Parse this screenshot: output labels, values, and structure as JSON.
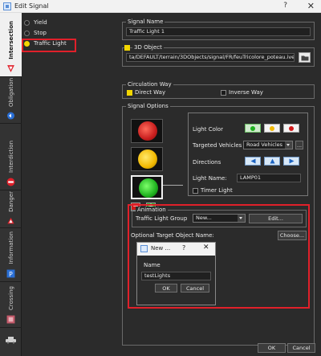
{
  "window": {
    "title": "Edit Signal",
    "help": "?",
    "close": "✕"
  },
  "tabs": [
    {
      "label": "Intersection"
    },
    {
      "label": "Obligation"
    },
    {
      "label": "Interdiction"
    },
    {
      "label": "Danger"
    },
    {
      "label": "Information"
    },
    {
      "label": "Crossing"
    }
  ],
  "signal_types": [
    {
      "label": "Yield",
      "selected": false
    },
    {
      "label": "Stop",
      "selected": false
    },
    {
      "label": "Traffic Light",
      "selected": true
    }
  ],
  "signal_name": {
    "label": "Signal Name",
    "value": "Traffic Light 1"
  },
  "object3d": {
    "label": "3D Object",
    "path": "ta/DEFAULT/terrain/3DObjects/signal/FR/feuTricolore_poteau.ive"
  },
  "circulation": {
    "label": "Circulation Way",
    "direct": "Direct Way",
    "inverse": "Inverse Way"
  },
  "options": {
    "label": "Signal Options",
    "light_color_label": "Light Color",
    "targeted_vehicles_label": "Targeted Vehicles",
    "targeted_vehicles_value": "Road Vehicles",
    "more_label": "...",
    "directions_label": "Directions",
    "light_name_label": "Light Name:",
    "light_name_value": "LAMP01",
    "timer_label": "Timer Light",
    "remove_label": "−",
    "add_label": "+"
  },
  "animation": {
    "label": "Animation",
    "group_label": "Traffic Light Group",
    "group_value": "New...",
    "edit_label": "Edit...",
    "target_label": "Optional Target Object Name:",
    "choose_label": "Choose..."
  },
  "mini_dialog": {
    "title": "New ...",
    "help": "?",
    "close": "✕",
    "name_label": "Name",
    "name_value": "testLights",
    "ok": "OK",
    "cancel": "Cancel"
  },
  "footer": {
    "ok": "OK",
    "cancel": "Cancel"
  },
  "colors": {
    "accent_yellow": "#f3d600",
    "highlight_red": "#e0202a",
    "panel": "#2b2b2b"
  }
}
